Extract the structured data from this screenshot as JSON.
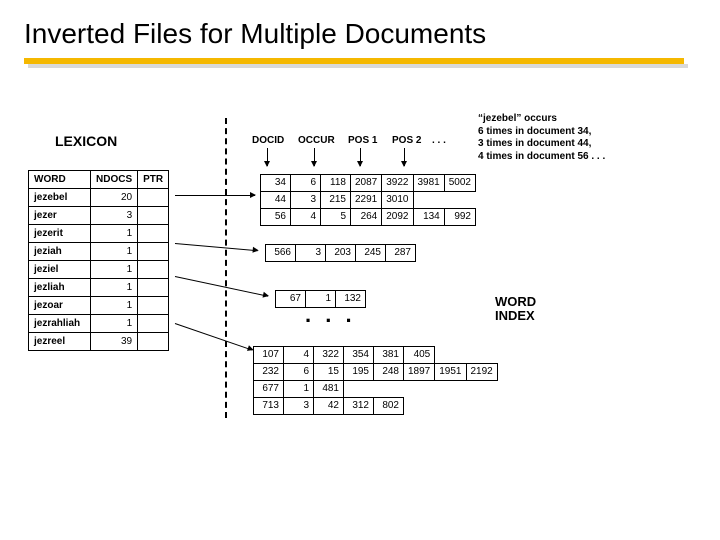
{
  "title": "Inverted Files for Multiple Documents",
  "lexicon_label": "LEXICON",
  "wordindex_label_l1": "WORD",
  "wordindex_label_l2": "INDEX",
  "big_ellipsis": ". . .",
  "headers": {
    "docid": "DOCID",
    "occur": "OCCUR",
    "pos1": "POS 1",
    "pos2": "POS 2",
    "dots": ". . ."
  },
  "note": {
    "l1": "“jezebel” occurs",
    "l2": "6 times in document 34,",
    "l3": "3 times in document 44,",
    "l4": "4 times in document 56 . . ."
  },
  "lexicon": {
    "cols": {
      "word": "WORD",
      "ndocs": "NDOCS",
      "ptr": "PTR"
    },
    "rows": [
      {
        "word": "jezebel",
        "ndocs": "20"
      },
      {
        "word": "jezer",
        "ndocs": "3"
      },
      {
        "word": "jezerit",
        "ndocs": "1"
      },
      {
        "word": "jeziah",
        "ndocs": "1"
      },
      {
        "word": "jeziel",
        "ndocs": "1"
      },
      {
        "word": "jezliah",
        "ndocs": "1"
      },
      {
        "word": "jezoar",
        "ndocs": "1"
      },
      {
        "word": "jezrahliah",
        "ndocs": "1"
      },
      {
        "word": "jezreel",
        "ndocs": "39"
      }
    ]
  },
  "postings": {
    "jezebel": [
      [
        "34",
        "6",
        "118",
        "2087",
        "3922",
        "3981",
        "5002"
      ],
      [
        "44",
        "3",
        "215",
        "2291",
        "3010",
        "",
        ""
      ],
      [
        "56",
        "4",
        "5",
        "264",
        "2092",
        "134",
        "992"
      ]
    ],
    "jeziah": [
      [
        "566",
        "3",
        "203",
        "245",
        "287"
      ]
    ],
    "jezliah": [
      [
        "67",
        "1",
        "132"
      ]
    ],
    "jezreel": [
      [
        "107",
        "4",
        "322",
        "354",
        "381",
        "405",
        ""
      ],
      [
        "232",
        "6",
        "15",
        "195",
        "248",
        "1897",
        "1951",
        "2192"
      ],
      [
        "677",
        "1",
        "481",
        "",
        "",
        "",
        "",
        ""
      ],
      [
        "713",
        "3",
        "42",
        "312",
        "802",
        "",
        "",
        ""
      ]
    ]
  }
}
